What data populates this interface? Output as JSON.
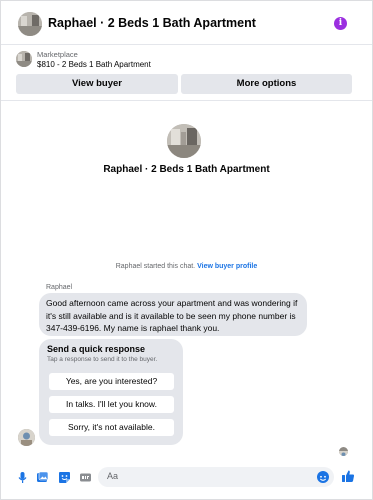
{
  "header": {
    "title": "Raphael · 2 Beds 1 Bath Apartment",
    "info_icon": "i"
  },
  "marketplace": {
    "label": "Marketplace",
    "listing": "$810 - 2 Beds 1 Bath Apartment",
    "view_buyer": "View buyer",
    "more_options": "More options"
  },
  "chat_intro": {
    "title": "Raphael · 2 Beds 1 Bath Apartment",
    "started_text": "Raphael started this chat.",
    "view_profile": "View buyer profile"
  },
  "message": {
    "sender": "Raphael",
    "text": "Good afternoon came across your apartment and was wondering if it's still available and is it available to be seen my phone number is 347-439-6196. My name is raphael thank you."
  },
  "quick_response": {
    "title": "Send a quick response",
    "subtitle": "Tap a response to send it to the buyer.",
    "options": [
      "Yes, are you interested?",
      "In talks. I'll let you know.",
      "Sorry, it's not available."
    ]
  },
  "composer": {
    "placeholder": "Aa"
  },
  "colors": {
    "accent": "#1b74e4",
    "info": "#9b2fe0",
    "bubble": "#e4e6eb"
  }
}
